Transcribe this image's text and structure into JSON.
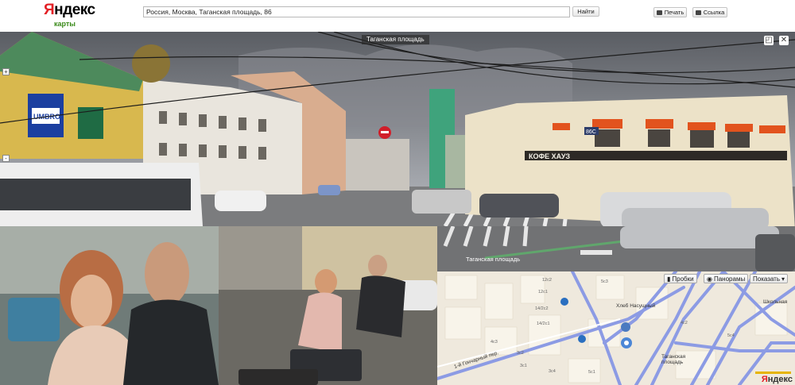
{
  "header": {
    "logo_first": "Я",
    "logo_rest": "ндекс",
    "logo_sub": "карты",
    "search_value": "Россия, Москва, Таганская площадь, 86",
    "find_label": "Найти",
    "print_label": "Печать",
    "link_label": "Ссылка"
  },
  "panorama": {
    "place_label": "Таганская площадь",
    "zoom_in": "+",
    "zoom_out": "-",
    "shop_sign": "КОФЕ ХАУЗ",
    "umbro_sign": "UMBRO",
    "building_number": "86С"
  },
  "street_panel": {
    "street_label": "Таганская площадь"
  },
  "map": {
    "controls": {
      "traffic": "Пробки",
      "panoramas": "Панорамы",
      "show": "Показать"
    },
    "labels": {
      "bakery": "Хлеб Насущный",
      "square": "Таганская площадь",
      "lane": "1-й Гончарный пер.",
      "school": "Школьная",
      "nums": [
        "12с2",
        "12с1",
        "5с3",
        "14/2с2",
        "14/2с1",
        "4с3",
        "3с2",
        "3с1",
        "3с4",
        "5с1",
        "4с2",
        "5с4"
      ]
    },
    "logo_first": "Я",
    "logo_rest": "ндекс"
  },
  "colors": {
    "road": "#8c9be4",
    "building": "#f6f1e6",
    "accent_red": "#e31e24",
    "cafe_orange": "#e2531e"
  }
}
